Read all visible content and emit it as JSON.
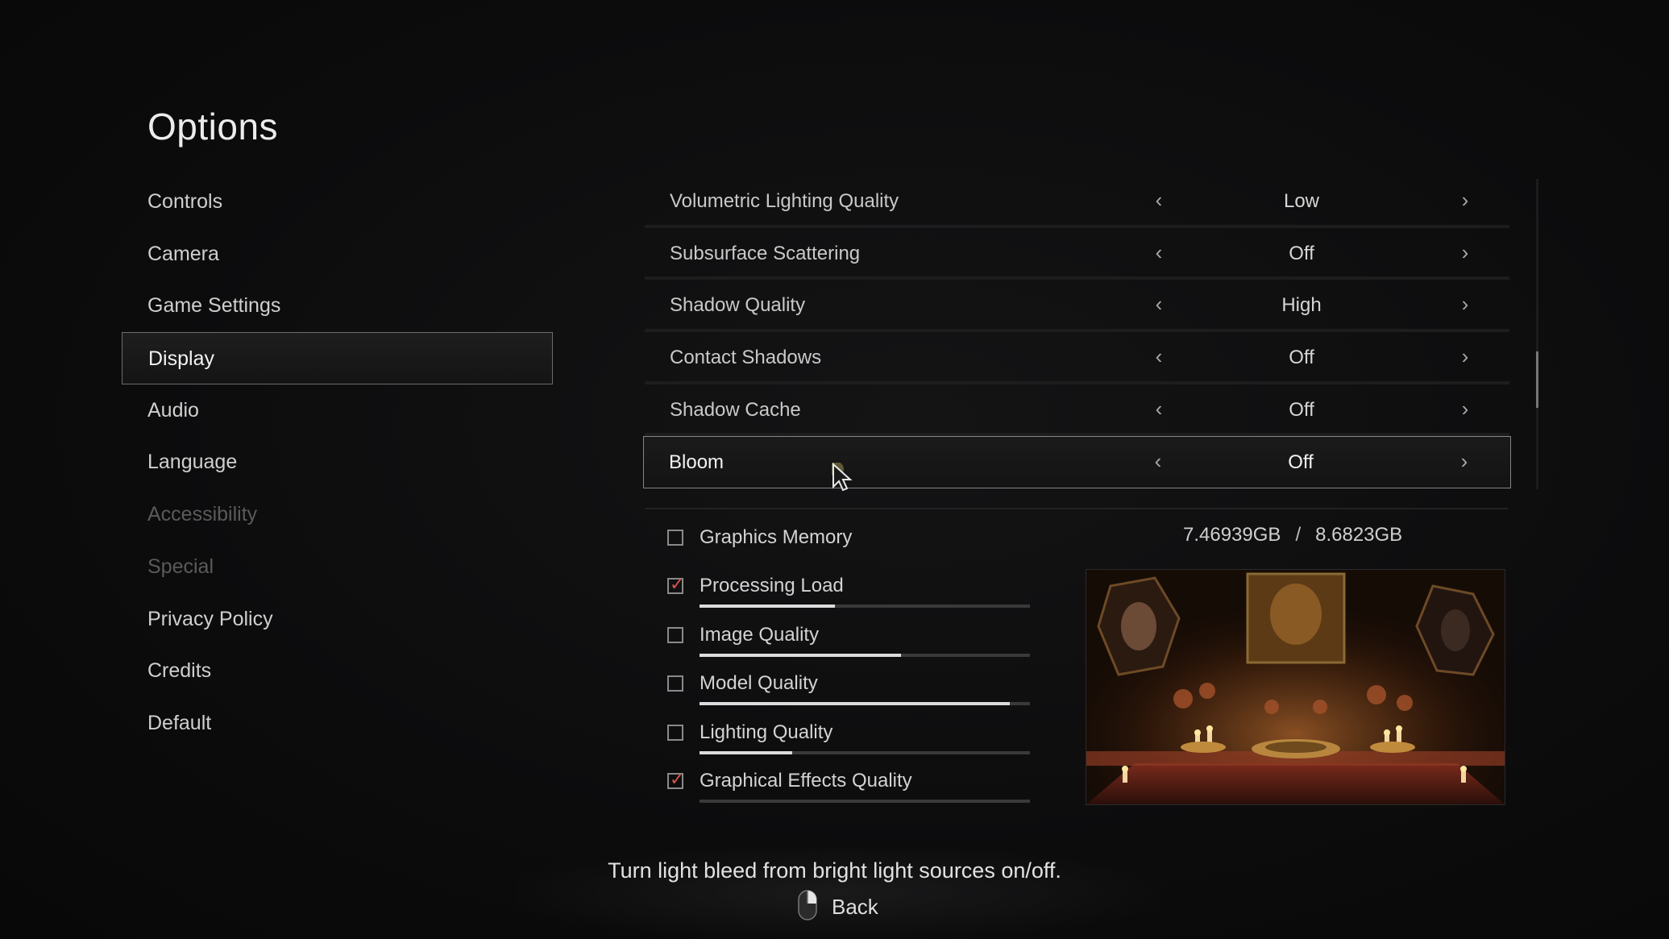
{
  "title": "Options",
  "nav": [
    {
      "label": "Controls",
      "state": "normal"
    },
    {
      "label": "Camera",
      "state": "normal"
    },
    {
      "label": "Game Settings",
      "state": "normal"
    },
    {
      "label": "Display",
      "state": "active"
    },
    {
      "label": "Audio",
      "state": "normal"
    },
    {
      "label": "Language",
      "state": "normal"
    },
    {
      "label": "Accessibility",
      "state": "disabled"
    },
    {
      "label": "Special",
      "state": "disabled"
    },
    {
      "label": "Privacy Policy",
      "state": "normal"
    },
    {
      "label": "Credits",
      "state": "normal"
    },
    {
      "label": "Default",
      "state": "normal"
    }
  ],
  "settings": [
    {
      "label": "Volumetric Lighting Quality",
      "value": "Low"
    },
    {
      "label": "Subsurface Scattering",
      "value": "Off"
    },
    {
      "label": "Shadow Quality",
      "value": "High"
    },
    {
      "label": "Contact Shadows",
      "value": "Off"
    },
    {
      "label": "Shadow Cache",
      "value": "Off"
    },
    {
      "label": "Bloom",
      "value": "Off",
      "selected": true
    }
  ],
  "arrows": {
    "left": "‹",
    "right": "›"
  },
  "memory": {
    "label": "Graphics Memory",
    "checked": false,
    "used": "7.46939GB",
    "separator": "/",
    "total": "8.6823GB"
  },
  "metrics": [
    {
      "label": "Processing Load",
      "checked": true,
      "level": 0.41
    },
    {
      "label": "Image Quality",
      "checked": false,
      "level": 0.61
    },
    {
      "label": "Model Quality",
      "checked": false,
      "level": 0.94
    },
    {
      "label": "Lighting Quality",
      "checked": false,
      "level": 0.28
    },
    {
      "label": "Graphical Effects Quality",
      "checked": true,
      "level": 0.0
    }
  ],
  "check_glyph": "✓",
  "description": "Turn light bleed from bright light sources on/off.",
  "back_label": "Back",
  "scroll_position": 0.68,
  "colors": {
    "accent_check": "#d0554a",
    "selected_border": "#858585",
    "background": "#0c0c0d"
  },
  "icons": {
    "cursor": "mouse-pointer-icon",
    "back": "mouse-right-button-icon",
    "arrow_left": "chevron-left-icon",
    "arrow_right": "chevron-right-icon"
  }
}
